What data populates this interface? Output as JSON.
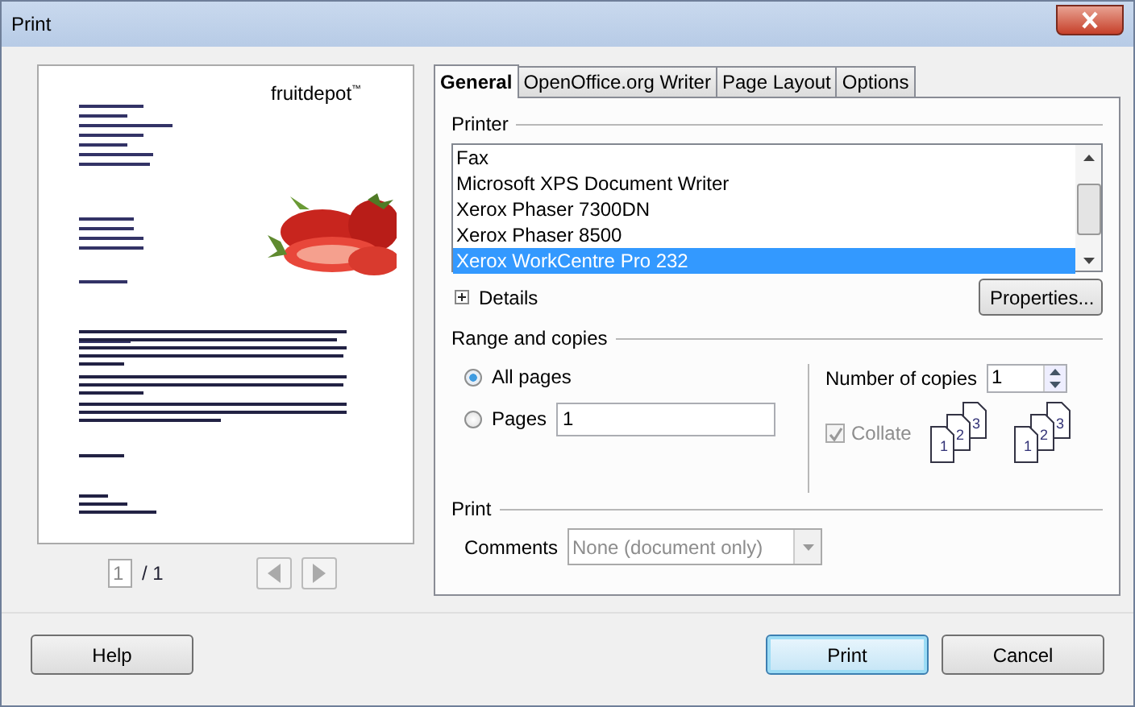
{
  "window": {
    "title": "Print"
  },
  "preview": {
    "logo": "fruitdepot",
    "logo_mark": "™",
    "page_field": "1",
    "page_total": "/ 1"
  },
  "tabs": [
    {
      "label": "General",
      "selected": true
    },
    {
      "label": "OpenOffice.org Writer",
      "selected": false
    },
    {
      "label": "Page Layout",
      "selected": false
    },
    {
      "label": "Options",
      "selected": false
    }
  ],
  "printer": {
    "heading": "Printer",
    "printers": [
      {
        "name": "Fax",
        "selected": false
      },
      {
        "name": "Microsoft XPS Document Writer",
        "selected": false
      },
      {
        "name": "Xerox Phaser 7300DN",
        "selected": false
      },
      {
        "name": "Xerox Phaser 8500",
        "selected": false
      },
      {
        "name": "Xerox WorkCentre Pro 232",
        "selected": true
      }
    ],
    "details": {
      "label": "Details",
      "expanded": false
    },
    "properties_button": "Properties..."
  },
  "range": {
    "heading": "Range and copies",
    "options": [
      {
        "label": "All pages",
        "selected": true
      },
      {
        "label": "Pages",
        "selected": false,
        "value": "1"
      }
    ],
    "copies_label": "Number of copies",
    "copies": "1",
    "collate": {
      "label": "Collate",
      "checked": true,
      "disabled": true
    },
    "collate_icons": [
      {
        "pages": [
          "1",
          "2",
          "3"
        ]
      },
      {
        "pages": [
          "1",
          "2",
          "3"
        ]
      }
    ]
  },
  "print": {
    "heading": "Print",
    "comments_label": "Comments",
    "comments_value": "None (document only)",
    "disabled": true
  },
  "buttons": [
    {
      "label": "Help",
      "default": false
    },
    {
      "label": "Print",
      "default": true
    },
    {
      "label": "Cancel",
      "default": false
    }
  ]
}
